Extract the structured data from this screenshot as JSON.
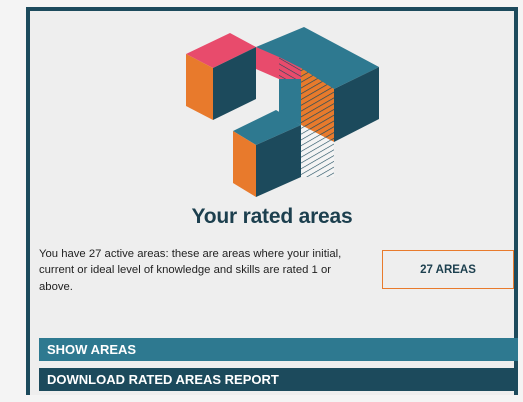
{
  "rated_areas": {
    "title": "Your rated areas",
    "description": "You have 27 active areas: these are areas where your initial, current or ideal level of knowledge and skills are rated 1 or above.",
    "count_label": "27 AREAS"
  },
  "actions": {
    "show_areas": "SHOW AREAS",
    "download_report": "DOWNLOAD RATED AREAS REPORT"
  },
  "colors": {
    "navy": "#1c4a5c",
    "teal": "#2e7990",
    "orange": "#e87a2c",
    "pink": "#e84b6c"
  },
  "icons": {
    "hero": "isometric-cubes-illustration"
  }
}
